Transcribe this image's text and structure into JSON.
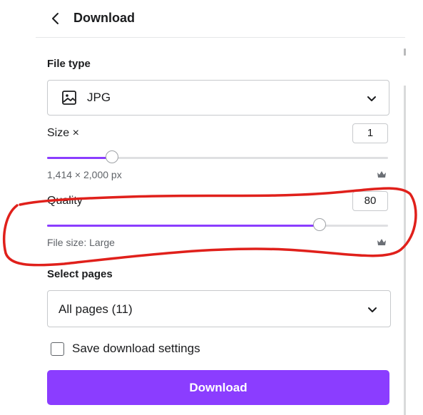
{
  "header": {
    "title": "Download",
    "back_icon": "chevron-left-icon"
  },
  "file_type": {
    "label": "File type",
    "value": "JPG",
    "icon": "image-icon"
  },
  "size": {
    "label": "Size ×",
    "value": "1",
    "dimensions": "1,414 × 2,000 px",
    "slider_fraction": 0.19
  },
  "quality": {
    "label": "Quality",
    "value": "80",
    "file_size": "File size: Large",
    "slider_fraction": 0.8
  },
  "select_pages": {
    "label": "Select pages",
    "value": "All pages (11)"
  },
  "save_settings": {
    "label": "Save download settings",
    "checked": false
  },
  "download_button": {
    "label": "Download"
  },
  "colors": {
    "accent": "#8b3dff",
    "annotation": "#e0201b"
  }
}
